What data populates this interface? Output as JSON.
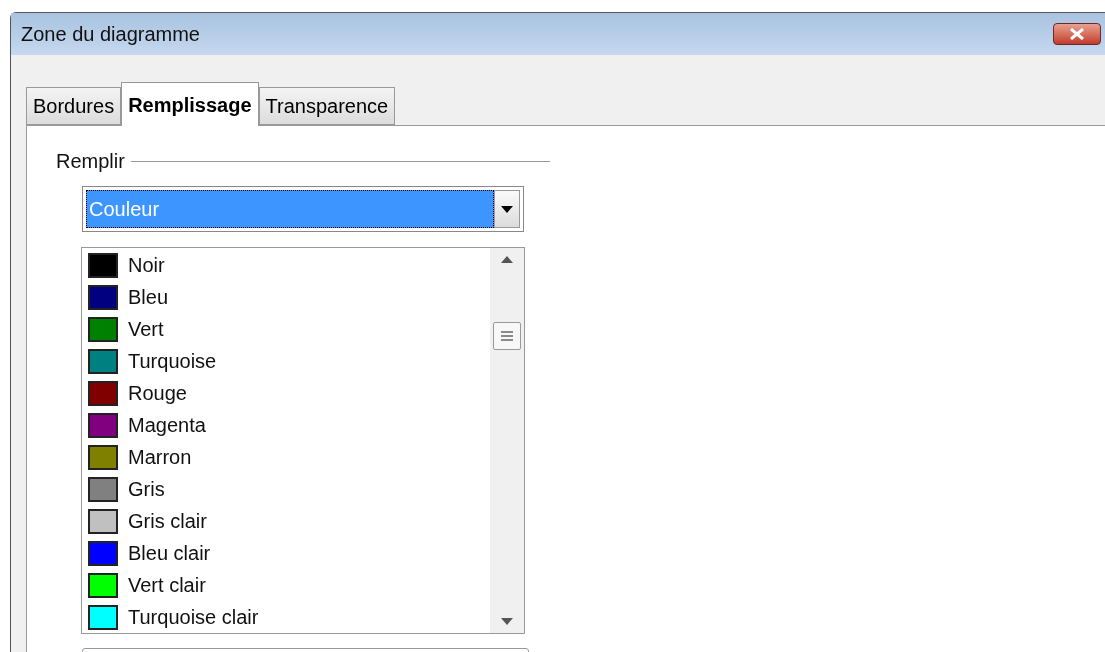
{
  "window": {
    "title": "Zone du diagramme"
  },
  "tabs": [
    {
      "label": "Bordures",
      "selected": false
    },
    {
      "label": "Remplissage",
      "selected": true
    },
    {
      "label": "Transparence",
      "selected": false
    }
  ],
  "fill": {
    "label": "Remplir",
    "dropdown": {
      "value": "Couleur"
    },
    "colors": [
      {
        "name": "Noir",
        "color": "#000000"
      },
      {
        "name": "Bleu",
        "color": "#000080"
      },
      {
        "name": "Vert",
        "color": "#008000"
      },
      {
        "name": "Turquoise",
        "color": "#008080"
      },
      {
        "name": "Rouge",
        "color": "#800000"
      },
      {
        "name": "Magenta",
        "color": "#800080"
      },
      {
        "name": "Marron",
        "color": "#808000"
      },
      {
        "name": "Gris",
        "color": "#808080"
      },
      {
        "name": "Gris clair",
        "color": "#c0c0c0"
      },
      {
        "name": "Bleu clair",
        "color": "#0000ff"
      },
      {
        "name": "Vert clair",
        "color": "#00ff00"
      },
      {
        "name": "Turquoise clair",
        "color": "#00ffff"
      }
    ]
  }
}
